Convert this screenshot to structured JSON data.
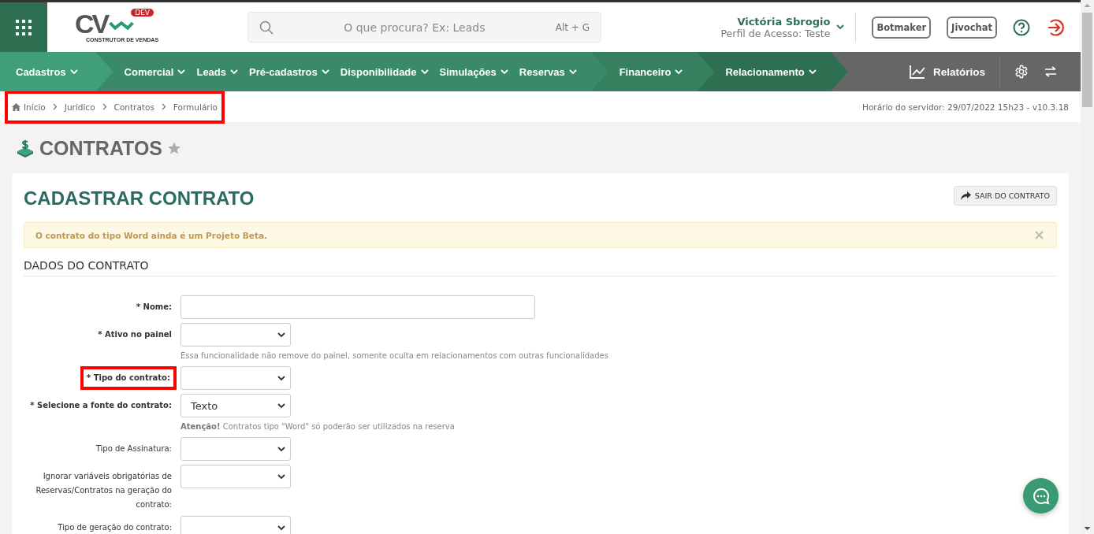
{
  "header": {
    "logo": {
      "letters": "CV",
      "badge": "DEV",
      "tagline": "CONSTRUTOR DE VENDAS"
    },
    "search": {
      "placeholder": "O que procura? Ex: Leads",
      "shortcut": "Alt + G"
    },
    "user": {
      "name": "Victória Sbrogio",
      "profile": "Perfil de Acesso: Teste"
    },
    "buttons": [
      "Botmaker",
      "Jivochat"
    ]
  },
  "nav": {
    "sections": [
      {
        "color": "#419e7a",
        "items": [
          "Cadastros"
        ]
      },
      {
        "color": "#3a8a69",
        "items": [
          "Comercial",
          "Leads",
          "Pré-cadastros",
          "Disponibilidade",
          "Simulações",
          "Reservas"
        ]
      },
      {
        "color": "#36805f",
        "items": [
          "Financeiro"
        ]
      },
      {
        "color": "#2e6f52",
        "items": [
          "Relacionamento"
        ]
      }
    ],
    "reports": "Relatórios"
  },
  "breadcrumb": {
    "highlighted": true,
    "items": [
      "Início",
      "Jurídico",
      "Contratos",
      "Formulário"
    ],
    "server_time": "Horário do servidor: 29/07/2022 15h23 - v10.3.18"
  },
  "page": {
    "title": "CONTRATOS",
    "favorite": false
  },
  "card": {
    "title": "CADASTRAR CONTRATO",
    "exit_button": "SAIR DO CONTRATO",
    "alert": "O contrato do tipo Word ainda é um Projeto Beta.",
    "section": "DADOS DO CONTRATO",
    "fields": [
      {
        "label": "* Nome:",
        "required": true,
        "kind": "text",
        "highlighted": false
      },
      {
        "label": "* Ativo no painel",
        "required": true,
        "kind": "select",
        "highlighted": false,
        "hint": "Essa funcionalidade não remove do painel, somente oculta em relacionamentos com outras funcionalidades"
      },
      {
        "label": "* Tipo do contrato:",
        "required": true,
        "kind": "select",
        "highlighted": true
      },
      {
        "label": "* Selecione a fonte do contrato:",
        "required": true,
        "kind": "select",
        "value": "Texto",
        "highlighted": false,
        "hint": "**Atenção!** Contratos tipo \"Word\" só poderão ser utilizados na reserva"
      },
      {
        "label": "Tipo de Assinatura:",
        "required": false,
        "kind": "select",
        "highlighted": false
      },
      {
        "label": "Ignorar variáveis obrigatórias de Reservas/Contratos na geração do contrato:",
        "required": false,
        "kind": "select",
        "highlighted": false
      },
      {
        "label": "Tipo de geração do contrato:",
        "required": false,
        "kind": "select",
        "highlighted": false
      }
    ]
  }
}
